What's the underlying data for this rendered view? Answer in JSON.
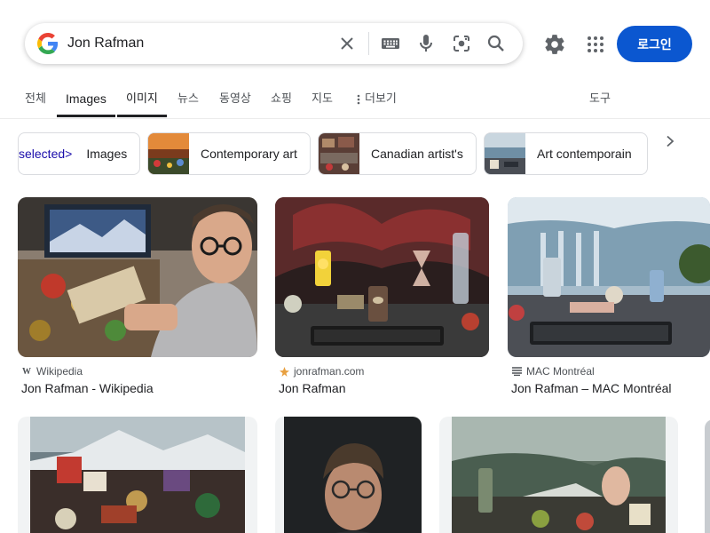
{
  "search": {
    "query": "Jon Rafman",
    "clear_label": "×"
  },
  "header": {
    "login_label": "로그인"
  },
  "tabs": [
    {
      "label": "전체"
    },
    {
      "label": "Images"
    },
    {
      "label": "이미지"
    },
    {
      "label": "뉴스"
    },
    {
      "label": "동영상"
    },
    {
      "label": "쇼핑"
    },
    {
      "label": "지도"
    },
    {
      "label": "더보기"
    },
    {
      "label": "도구"
    }
  ],
  "chips": [
    {
      "prefix": "selected>",
      "label": "Images"
    },
    {
      "label": "Contemporary art"
    },
    {
      "label": "Canadian artist's"
    },
    {
      "label": "Art contemporain"
    }
  ],
  "results": [
    {
      "source": "Wikipedia",
      "title": "Jon Rafman - Wikipedia"
    },
    {
      "source": "jonrafman.com",
      "title": "Jon Rafman"
    },
    {
      "source": "MAC Montréal",
      "title": "Jon Rafman – MAC Montréal"
    }
  ],
  "colors": {
    "accent": "#0b57d0",
    "google_blue": "#4285F4",
    "google_red": "#EA4335",
    "google_yellow": "#FBBC05",
    "google_green": "#34A853"
  },
  "icons": {
    "logo": "google-g-logo",
    "clear": "close-icon",
    "keyboard": "keyboard-icon",
    "voice": "microphone-icon",
    "lens": "lens-camera-icon",
    "search": "search-icon",
    "settings": "gear-icon",
    "apps": "apps-grid-icon",
    "more": "more-vert-icon",
    "next": "chevron-right-icon"
  }
}
